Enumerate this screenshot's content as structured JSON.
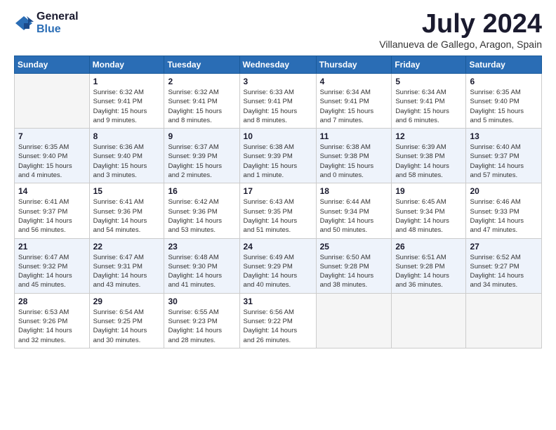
{
  "header": {
    "logo": {
      "general": "General",
      "blue": "Blue"
    },
    "title": "July 2024",
    "subtitle": "Villanueva de Gallego, Aragon, Spain"
  },
  "days_of_week": [
    "Sunday",
    "Monday",
    "Tuesday",
    "Wednesday",
    "Thursday",
    "Friday",
    "Saturday"
  ],
  "weeks": [
    [
      {
        "day": "",
        "info": ""
      },
      {
        "day": "1",
        "info": "Sunrise: 6:32 AM\nSunset: 9:41 PM\nDaylight: 15 hours\nand 9 minutes."
      },
      {
        "day": "2",
        "info": "Sunrise: 6:32 AM\nSunset: 9:41 PM\nDaylight: 15 hours\nand 8 minutes."
      },
      {
        "day": "3",
        "info": "Sunrise: 6:33 AM\nSunset: 9:41 PM\nDaylight: 15 hours\nand 8 minutes."
      },
      {
        "day": "4",
        "info": "Sunrise: 6:34 AM\nSunset: 9:41 PM\nDaylight: 15 hours\nand 7 minutes."
      },
      {
        "day": "5",
        "info": "Sunrise: 6:34 AM\nSunset: 9:41 PM\nDaylight: 15 hours\nand 6 minutes."
      },
      {
        "day": "6",
        "info": "Sunrise: 6:35 AM\nSunset: 9:40 PM\nDaylight: 15 hours\nand 5 minutes."
      }
    ],
    [
      {
        "day": "7",
        "info": "Sunrise: 6:35 AM\nSunset: 9:40 PM\nDaylight: 15 hours\nand 4 minutes."
      },
      {
        "day": "8",
        "info": "Sunrise: 6:36 AM\nSunset: 9:40 PM\nDaylight: 15 hours\nand 3 minutes."
      },
      {
        "day": "9",
        "info": "Sunrise: 6:37 AM\nSunset: 9:39 PM\nDaylight: 15 hours\nand 2 minutes."
      },
      {
        "day": "10",
        "info": "Sunrise: 6:38 AM\nSunset: 9:39 PM\nDaylight: 15 hours\nand 1 minute."
      },
      {
        "day": "11",
        "info": "Sunrise: 6:38 AM\nSunset: 9:38 PM\nDaylight: 15 hours\nand 0 minutes."
      },
      {
        "day": "12",
        "info": "Sunrise: 6:39 AM\nSunset: 9:38 PM\nDaylight: 14 hours\nand 58 minutes."
      },
      {
        "day": "13",
        "info": "Sunrise: 6:40 AM\nSunset: 9:37 PM\nDaylight: 14 hours\nand 57 minutes."
      }
    ],
    [
      {
        "day": "14",
        "info": "Sunrise: 6:41 AM\nSunset: 9:37 PM\nDaylight: 14 hours\nand 56 minutes."
      },
      {
        "day": "15",
        "info": "Sunrise: 6:41 AM\nSunset: 9:36 PM\nDaylight: 14 hours\nand 54 minutes."
      },
      {
        "day": "16",
        "info": "Sunrise: 6:42 AM\nSunset: 9:36 PM\nDaylight: 14 hours\nand 53 minutes."
      },
      {
        "day": "17",
        "info": "Sunrise: 6:43 AM\nSunset: 9:35 PM\nDaylight: 14 hours\nand 51 minutes."
      },
      {
        "day": "18",
        "info": "Sunrise: 6:44 AM\nSunset: 9:34 PM\nDaylight: 14 hours\nand 50 minutes."
      },
      {
        "day": "19",
        "info": "Sunrise: 6:45 AM\nSunset: 9:34 PM\nDaylight: 14 hours\nand 48 minutes."
      },
      {
        "day": "20",
        "info": "Sunrise: 6:46 AM\nSunset: 9:33 PM\nDaylight: 14 hours\nand 47 minutes."
      }
    ],
    [
      {
        "day": "21",
        "info": "Sunrise: 6:47 AM\nSunset: 9:32 PM\nDaylight: 14 hours\nand 45 minutes."
      },
      {
        "day": "22",
        "info": "Sunrise: 6:47 AM\nSunset: 9:31 PM\nDaylight: 14 hours\nand 43 minutes."
      },
      {
        "day": "23",
        "info": "Sunrise: 6:48 AM\nSunset: 9:30 PM\nDaylight: 14 hours\nand 41 minutes."
      },
      {
        "day": "24",
        "info": "Sunrise: 6:49 AM\nSunset: 9:29 PM\nDaylight: 14 hours\nand 40 minutes."
      },
      {
        "day": "25",
        "info": "Sunrise: 6:50 AM\nSunset: 9:28 PM\nDaylight: 14 hours\nand 38 minutes."
      },
      {
        "day": "26",
        "info": "Sunrise: 6:51 AM\nSunset: 9:28 PM\nDaylight: 14 hours\nand 36 minutes."
      },
      {
        "day": "27",
        "info": "Sunrise: 6:52 AM\nSunset: 9:27 PM\nDaylight: 14 hours\nand 34 minutes."
      }
    ],
    [
      {
        "day": "28",
        "info": "Sunrise: 6:53 AM\nSunset: 9:26 PM\nDaylight: 14 hours\nand 32 minutes."
      },
      {
        "day": "29",
        "info": "Sunrise: 6:54 AM\nSunset: 9:25 PM\nDaylight: 14 hours\nand 30 minutes."
      },
      {
        "day": "30",
        "info": "Sunrise: 6:55 AM\nSunset: 9:23 PM\nDaylight: 14 hours\nand 28 minutes."
      },
      {
        "day": "31",
        "info": "Sunrise: 6:56 AM\nSunset: 9:22 PM\nDaylight: 14 hours\nand 26 minutes."
      },
      {
        "day": "",
        "info": ""
      },
      {
        "day": "",
        "info": ""
      },
      {
        "day": "",
        "info": ""
      }
    ]
  ]
}
